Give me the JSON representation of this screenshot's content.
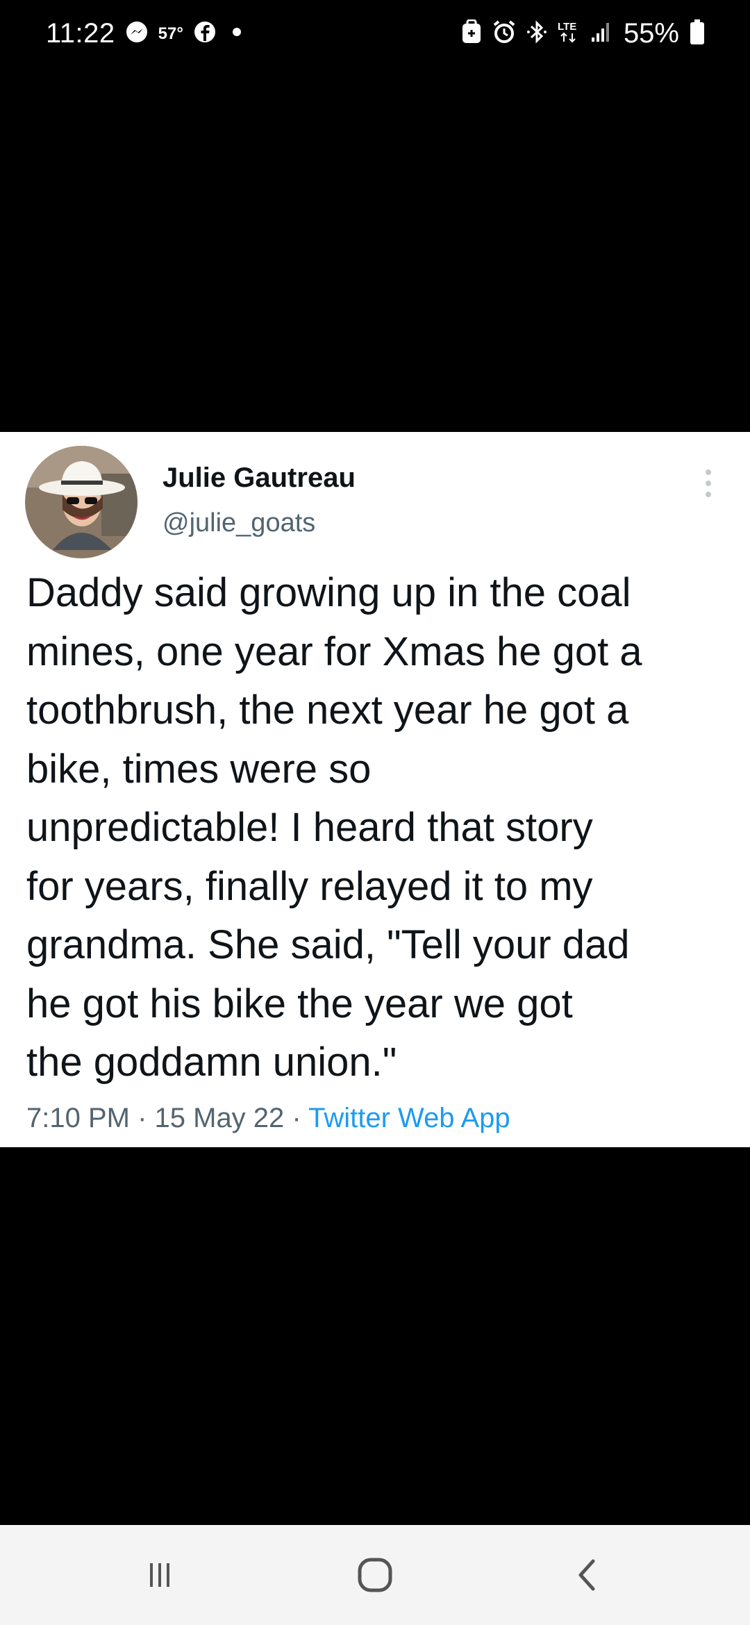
{
  "status_bar": {
    "time": "11:22",
    "temperature": "57°",
    "battery": "55%",
    "network": "LTE",
    "icons": [
      "messenger-icon",
      "facebook-icon",
      "dot-icon",
      "nfc-icon",
      "alarm-icon",
      "bluetooth-icon",
      "lte-icon",
      "signal-icon",
      "battery-icon"
    ]
  },
  "tweet": {
    "author_name": "Julie Gautreau",
    "author_handle": "@julie_goats",
    "text_lines": [
      "Daddy said growing up in the coal",
      "mines, one year for Xmas he got a",
      "toothbrush, the next year he got a",
      "bike, times were so",
      "unpredictable! I heard that story",
      "for years, finally relayed it to my",
      "grandma. She said, \"Tell your dad",
      "he got his bike the year we got",
      "the goddamn union.\""
    ],
    "timestamp": "7:10 PM · 15 May 22 · ",
    "source": "Twitter Web App",
    "source_color": "#1d9bf0"
  },
  "nav_bar": {
    "buttons": [
      "recents-icon",
      "home-icon",
      "back-icon"
    ]
  }
}
